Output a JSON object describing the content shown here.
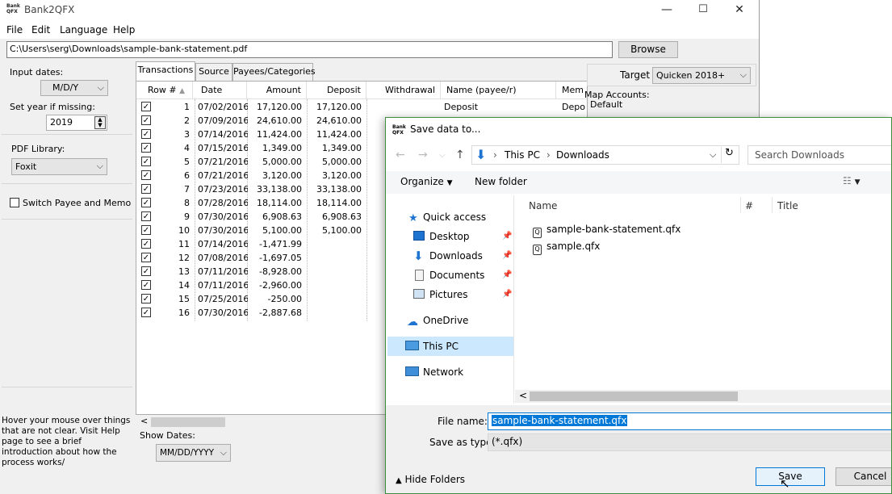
{
  "app": {
    "title": "Bank2QFX",
    "icon_text_top": "Bank",
    "icon_text_bottom": "QFX"
  },
  "window_controls": {
    "minimize": "—",
    "maximize": "☐",
    "close": "✕"
  },
  "menu": [
    "File",
    "Edit",
    "Language",
    "Help"
  ],
  "path": {
    "value": "C:\\Users\\serg\\Downloads\\sample-bank-statement.pdf",
    "browse_label": "Browse"
  },
  "left": {
    "input_dates_label": "Input dates:",
    "input_dates_value": "M/D/Y",
    "set_year_label": "Set year if missing:",
    "set_year_value": "2019",
    "pdf_library_label": "PDF Library:",
    "pdf_library_value": "Foxit",
    "switch_label": "Switch Payee and Memo",
    "hint": "Hover your mouse over things that are not clear. Visit Help page to see a brief introduction about how the process works/"
  },
  "tabs": [
    "Transactions",
    "Source",
    "Payees/Categories"
  ],
  "grid": {
    "headers": [
      "Row #",
      "Date",
      "Amount",
      "Deposit",
      "Withdrawal",
      "Name (payee/r)",
      "Mem"
    ],
    "rows": [
      {
        "n": "1",
        "date": "07/02/2016",
        "amount": "17,120.00",
        "deposit": "17,120.00",
        "name": "Deposit",
        "memo": "Depo"
      },
      {
        "n": "2",
        "date": "07/09/2016",
        "amount": "24,610.00",
        "deposit": "24,610.00",
        "name": "",
        "memo": ""
      },
      {
        "n": "3",
        "date": "07/14/2016",
        "amount": "11,424.00",
        "deposit": "11,424.00",
        "name": "",
        "memo": ""
      },
      {
        "n": "4",
        "date": "07/15/2016",
        "amount": "1,349.00",
        "deposit": "1,349.00",
        "name": "",
        "memo": ""
      },
      {
        "n": "5",
        "date": "07/21/2016",
        "amount": "5,000.00",
        "deposit": "5,000.00",
        "name": "",
        "memo": ""
      },
      {
        "n": "6",
        "date": "07/21/2016",
        "amount": "3,120.00",
        "deposit": "3,120.00",
        "name": "",
        "memo": ""
      },
      {
        "n": "7",
        "date": "07/23/2016",
        "amount": "33,138.00",
        "deposit": "33,138.00",
        "name": "",
        "memo": ""
      },
      {
        "n": "8",
        "date": "07/28/2016",
        "amount": "18,114.00",
        "deposit": "18,114.00",
        "name": "",
        "memo": ""
      },
      {
        "n": "9",
        "date": "07/30/2016",
        "amount": "6,908.63",
        "deposit": "6,908.63",
        "name": "",
        "memo": ""
      },
      {
        "n": "10",
        "date": "07/30/2016",
        "amount": "5,100.00",
        "deposit": "5,100.00",
        "name": "",
        "memo": ""
      },
      {
        "n": "11",
        "date": "07/14/2016",
        "amount": "-1,471.99",
        "deposit": "",
        "name": "",
        "memo": ""
      },
      {
        "n": "12",
        "date": "07/08/2016",
        "amount": "-1,697.05",
        "deposit": "",
        "name": "",
        "memo": ""
      },
      {
        "n": "13",
        "date": "07/11/2016",
        "amount": "-8,928.00",
        "deposit": "",
        "name": "",
        "memo": ""
      },
      {
        "n": "14",
        "date": "07/11/2016",
        "amount": "-2,960.00",
        "deposit": "",
        "name": "",
        "memo": ""
      },
      {
        "n": "15",
        "date": "07/25/2016",
        "amount": "-250.00",
        "deposit": "",
        "name": "",
        "memo": ""
      },
      {
        "n": "16",
        "date": "07/30/2016",
        "amount": "-2,887.68",
        "deposit": "",
        "name": "",
        "memo": ""
      }
    ]
  },
  "show_dates": {
    "label": "Show Dates:",
    "value": "MM/DD/YYYY"
  },
  "right": {
    "target_label": "Target",
    "target_value": "Quicken 2018+",
    "map_label": "Map Accounts:",
    "default_label": "Default"
  },
  "dialog": {
    "title": "Save data to...",
    "breadcrumb": [
      "This PC",
      "Downloads"
    ],
    "search_placeholder": "Search Downloads",
    "organize_label": "Organize",
    "new_folder_label": "New folder",
    "nav_items": [
      "Quick access",
      "Desktop",
      "Downloads",
      "Documents",
      "Pictures",
      "OneDrive",
      "This PC",
      "Network"
    ],
    "columns": [
      "Name",
      "#",
      "Title"
    ],
    "files": [
      "sample-bank-statement.qfx",
      "sample.qfx"
    ],
    "file_name_label": "File name:",
    "file_name_value": "sample-bank-statement.qfx",
    "save_type_label": "Save as type:",
    "save_type_value": "(*.qfx)",
    "hide_folders_label": "Hide Folders",
    "save_label": "Save",
    "cancel_label": "Cancel"
  }
}
